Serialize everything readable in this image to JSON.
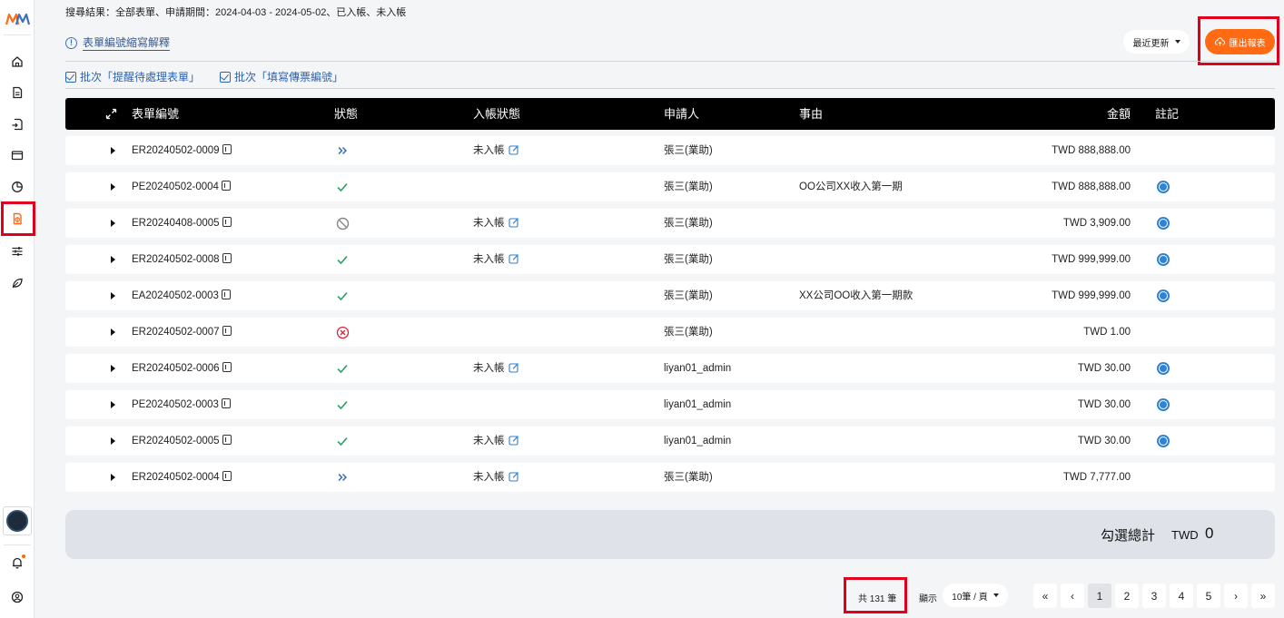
{
  "header": {
    "search_summary": "搜尋結果：全部表單、申請期間：2024-04-03 - 2024-05-02、已入帳、未入帳",
    "explain_link": "表單編號縮寫解釋",
    "sort_label": "最近更新",
    "export_label": "匯出報表"
  },
  "batch": {
    "remind_label": "批次「提醒待處理表單」",
    "fill_label": "批次「填寫傳票編號」"
  },
  "table": {
    "columns": {
      "form_no": "表單編號",
      "status": "狀態",
      "posting_status": "入帳狀態",
      "applicant": "申請人",
      "reason": "事由",
      "amount": "金額",
      "note": "註記"
    },
    "rows": [
      {
        "form_no": "ER20240502-0009",
        "status": "forward",
        "posting": "未入帳",
        "applicant": "張三(業助)",
        "reason": "",
        "amount": "TWD 888,888.00",
        "note": false
      },
      {
        "form_no": "PE20240502-0004",
        "status": "check",
        "posting": "",
        "applicant": "張三(業助)",
        "reason": "OO公司XX收入第一期",
        "amount": "TWD 888,888.00",
        "note": true
      },
      {
        "form_no": "ER20240408-0005",
        "status": "void",
        "posting": "未入帳",
        "applicant": "張三(業助)",
        "reason": "",
        "amount": "TWD 3,909.00",
        "note": true
      },
      {
        "form_no": "ER20240502-0008",
        "status": "check",
        "posting": "未入帳",
        "applicant": "張三(業助)",
        "reason": "",
        "amount": "TWD 999,999.00",
        "note": true
      },
      {
        "form_no": "EA20240502-0003",
        "status": "check",
        "posting": "",
        "applicant": "張三(業助)",
        "reason": "XX公司OO收入第一期款",
        "amount": "TWD 999,999.00",
        "note": true
      },
      {
        "form_no": "ER20240502-0007",
        "status": "reject",
        "posting": "",
        "applicant": "張三(業助)",
        "reason": "",
        "amount": "TWD 1.00",
        "note": false
      },
      {
        "form_no": "ER20240502-0006",
        "status": "check",
        "posting": "未入帳",
        "applicant": "liyan01_admin",
        "reason": "",
        "amount": "TWD 30.00",
        "note": true
      },
      {
        "form_no": "PE20240502-0003",
        "status": "check",
        "posting": "",
        "applicant": "liyan01_admin",
        "reason": "",
        "amount": "TWD 30.00",
        "note": true
      },
      {
        "form_no": "ER20240502-0005",
        "status": "check",
        "posting": "未入帳",
        "applicant": "liyan01_admin",
        "reason": "",
        "amount": "TWD 30.00",
        "note": true
      },
      {
        "form_no": "ER20240502-0004",
        "status": "forward",
        "posting": "未入帳",
        "applicant": "張三(業助)",
        "reason": "",
        "amount": "TWD 7,777.00",
        "note": false
      }
    ]
  },
  "totals": {
    "label": "勾選總計",
    "currency": "TWD",
    "value": "0"
  },
  "pagination": {
    "count_text": "共 131 筆",
    "display_label": "顯示",
    "page_size": "10筆 / 頁",
    "first": "«",
    "prev": "‹",
    "next": "›",
    "last": "»",
    "pages": [
      "1",
      "2",
      "3",
      "4",
      "5"
    ],
    "current_page": "1"
  },
  "icons": {
    "sidebar": [
      "logo-icon",
      "home-icon",
      "document-icon",
      "return-document-icon",
      "wallet-icon",
      "pie-chart-icon",
      "accounting-icon",
      "settings-sliders-icon",
      "leaf-icon",
      "bell-icon",
      "user-icon"
    ]
  },
  "colors": {
    "accent": "#ff6a13",
    "highlight": "#e0001b",
    "link": "#2a64b8",
    "success": "#18a058",
    "danger": "#e0243a",
    "info": "#2f82d4"
  }
}
